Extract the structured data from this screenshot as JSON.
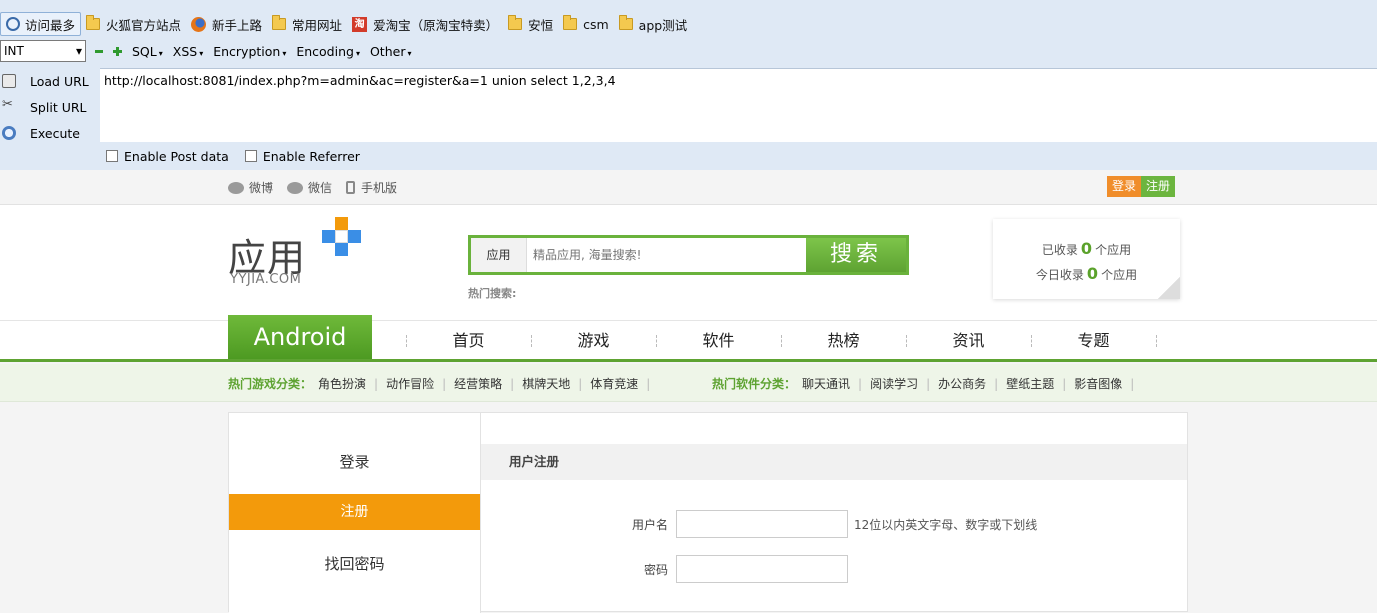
{
  "bookmarks": [
    {
      "label": "访问最多",
      "icon": "magnifier-icon"
    },
    {
      "label": "火狐官方站点",
      "icon": "folder-icon"
    },
    {
      "label": "新手上路",
      "icon": "firefox-icon"
    },
    {
      "label": "常用网址",
      "icon": "folder-icon"
    },
    {
      "label": "爱淘宝（原淘宝特卖）",
      "icon": "taobao-icon"
    },
    {
      "label": "安恒",
      "icon": "folder-icon"
    },
    {
      "label": "csm",
      "icon": "folder-icon"
    },
    {
      "label": "app测试",
      "icon": "folder-icon"
    }
  ],
  "hackbar": {
    "select_value": "INT",
    "menus": [
      "SQL",
      "XSS",
      "Encryption",
      "Encoding",
      "Other"
    ],
    "actions": [
      "Load URL",
      "Split URL",
      "Execute"
    ],
    "url": "http://localhost:8081/index.php?m=admin&ac=register&a=1 union select 1,2,3,4",
    "options": [
      "Enable Post data",
      "Enable Referrer"
    ]
  },
  "site": {
    "social": [
      "微博",
      "微信",
      "手机版"
    ],
    "login_label": "登录",
    "register_label": "注册",
    "logo_text": "应用",
    "logo_sub": "YYJIA.COM",
    "search_tag": "应用",
    "search_placeholder": "精品应用, 海量搜索!",
    "search_button": "搜索",
    "hot_search": "热门搜索:",
    "stats": {
      "line1_prefix": "已收录",
      "line1_value": "0",
      "line1_suffix": "个应用",
      "line2_prefix": "今日收录",
      "line2_value": "0",
      "line2_suffix": "个应用"
    },
    "nav_android": "Android",
    "nav": [
      "首页",
      "游戏",
      "软件",
      "热榜",
      "资讯",
      "专题"
    ],
    "game_cats_title": "热门游戏分类：",
    "game_cats": [
      "角色扮演",
      "动作冒险",
      "经营策略",
      "棋牌天地",
      "体育竞速"
    ],
    "soft_cats_title": "热门软件分类：",
    "soft_cats": [
      "聊天通讯",
      "阅读学习",
      "办公商务",
      "壁纸主题",
      "影音图像"
    ],
    "sidebar": [
      "登录",
      "注册",
      "找回密码"
    ],
    "form_title": "用户注册",
    "username_label": "用户名",
    "username_hint": "12位以内英文字母、数字或下划线",
    "password_label": "密码"
  },
  "colors": {
    "green": "#5ea332",
    "orange": "#f39a0b",
    "blue": "#3a8ee6"
  }
}
